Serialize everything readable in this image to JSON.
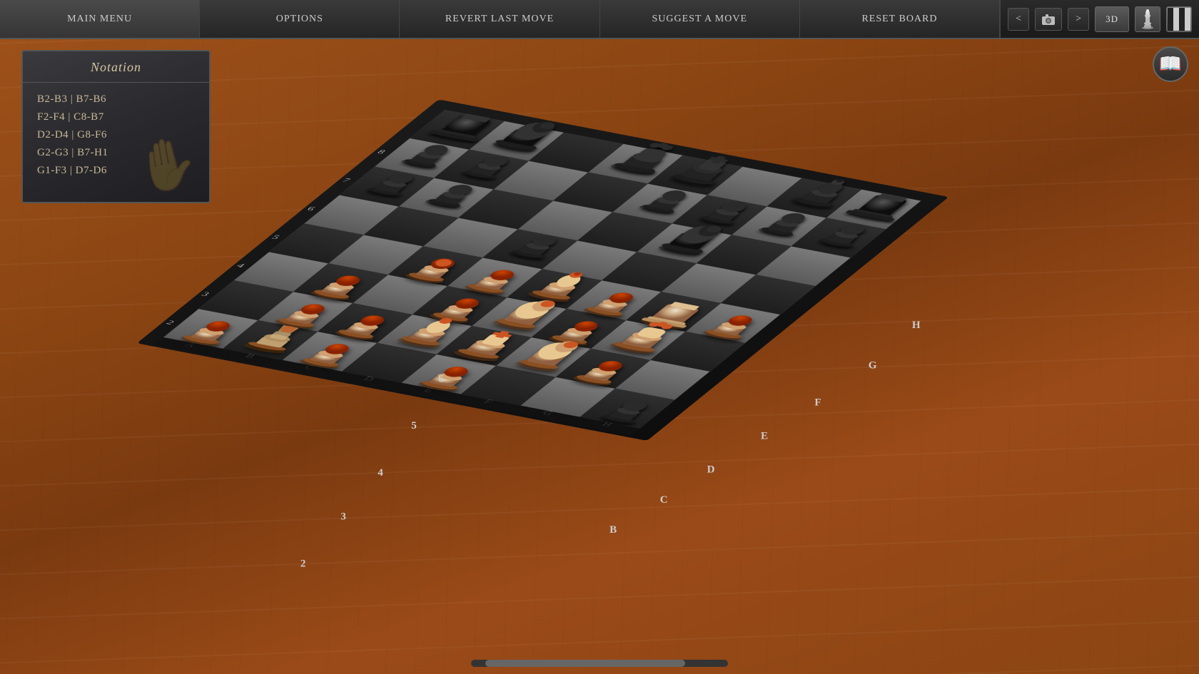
{
  "toolbar": {
    "buttons": [
      {
        "id": "main-menu",
        "label": "Main Menu"
      },
      {
        "id": "options",
        "label": "Options"
      },
      {
        "id": "revert",
        "label": "Revert Last Move"
      },
      {
        "id": "suggest",
        "label": "Suggest a Move"
      },
      {
        "id": "reset",
        "label": "Reset Board"
      }
    ],
    "view_mode": "3D",
    "nav_prev": "<",
    "nav_camera": "📷",
    "nav_next": ">"
  },
  "notation": {
    "title": "Notation",
    "moves": [
      "B2-B3  |  B7-B6",
      "F2-F4  |  C8-B7",
      "D2-D4  |  G8-F6",
      "G2-G3  |  B7-H1",
      "G1-F3  |  D7-D6"
    ]
  },
  "board": {
    "col_labels": [
      "H",
      "G",
      "F",
      "E",
      "D",
      "C",
      "B"
    ],
    "row_labels": [
      "2",
      "3",
      "4",
      "5"
    ],
    "pieces": "see layout"
  },
  "book_btn_label": "📖",
  "scrollbar": {
    "visible": true
  }
}
